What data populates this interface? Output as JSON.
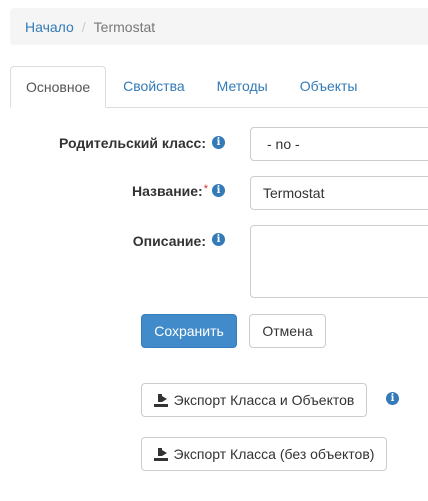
{
  "breadcrumb": {
    "home": "Начало",
    "separator": "/",
    "current": "Termostat"
  },
  "tabs": [
    {
      "label": "Основное",
      "active": true
    },
    {
      "label": "Свойства",
      "active": false
    },
    {
      "label": "Методы",
      "active": false
    },
    {
      "label": "Объекты",
      "active": false
    }
  ],
  "form": {
    "parent_label": "Родительский класс:",
    "parent_value": "- no -",
    "name_label": "Название:",
    "name_required": "*",
    "name_value": "Termostat",
    "description_label": "Описание:",
    "description_value": "",
    "info_glyph": "i"
  },
  "buttons": {
    "save": "Сохранить",
    "cancel": "Отмена",
    "export_with_objects": "Экспорт Класса и Объектов",
    "export_without_objects": "Экспорт Класса (без объектов)"
  },
  "colors": {
    "accent": "#337ab7",
    "primary_button": "#428bca",
    "required": "#c9302c"
  }
}
